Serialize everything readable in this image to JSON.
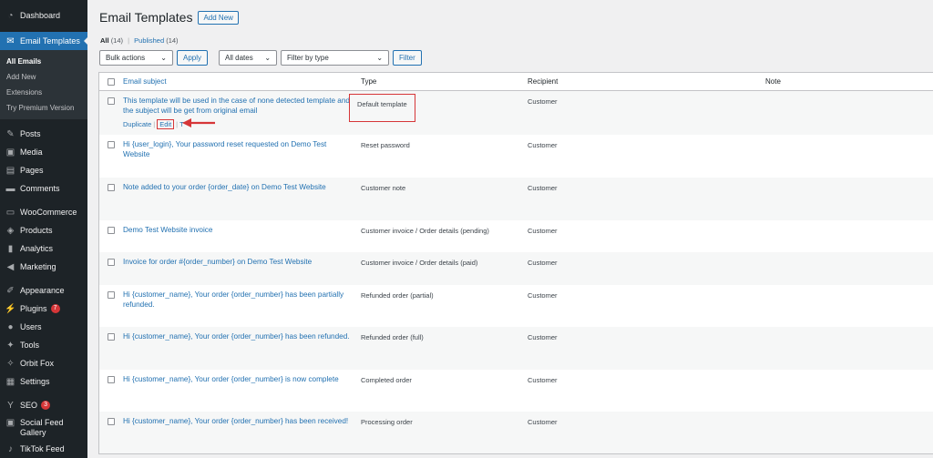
{
  "sidebar": {
    "items_top": [
      {
        "label": "Dashboard",
        "icon": "dashboard-icon",
        "glyph": "◔"
      }
    ],
    "current": {
      "label": "Email Templates",
      "icon": "email-icon",
      "glyph": "✉"
    },
    "submenu": [
      "All Emails",
      "Add New",
      "Extensions",
      "Try Premium Version"
    ],
    "items_mid": [
      {
        "label": "Posts",
        "icon": "pin-icon",
        "glyph": "✎"
      },
      {
        "label": "Media",
        "icon": "media-icon",
        "glyph": "▣"
      },
      {
        "label": "Pages",
        "icon": "pages-icon",
        "glyph": "▤"
      },
      {
        "label": "Comments",
        "icon": "comments-icon",
        "glyph": "▬"
      }
    ],
    "items_shop": [
      {
        "label": "WooCommerce",
        "icon": "woocommerce-icon",
        "glyph": "▭"
      },
      {
        "label": "Products",
        "icon": "products-icon",
        "glyph": "◈"
      },
      {
        "label": "Analytics",
        "icon": "analytics-icon",
        "glyph": "▮"
      },
      {
        "label": "Marketing",
        "icon": "marketing-icon",
        "glyph": "◀"
      }
    ],
    "items_admin": [
      {
        "label": "Appearance",
        "icon": "appearance-icon",
        "glyph": "✐"
      },
      {
        "label": "Plugins",
        "icon": "plugins-icon",
        "glyph": "⚡",
        "badge": "7"
      },
      {
        "label": "Users",
        "icon": "users-icon",
        "glyph": "●"
      },
      {
        "label": "Tools",
        "icon": "tools-icon",
        "glyph": "✦"
      },
      {
        "label": "Orbit Fox",
        "icon": "orbit-fox-icon",
        "glyph": "✧"
      },
      {
        "label": "Settings",
        "icon": "settings-icon",
        "glyph": "▦"
      }
    ],
    "items_bottom": [
      {
        "label": "SEO",
        "icon": "seo-icon",
        "glyph": "Y",
        "badge": "3"
      },
      {
        "label": "Social Feed Gallery",
        "icon": "social-feed-icon",
        "glyph": "▣"
      },
      {
        "label": "TikTok Feed",
        "icon": "tiktok-icon",
        "glyph": "♪"
      }
    ]
  },
  "header": {
    "title": "Email Templates",
    "add_new": "Add New"
  },
  "views": {
    "all": "All",
    "all_count": "(14)",
    "separator": "|",
    "published": "Published",
    "published_count": "(14)"
  },
  "filters": {
    "bulk_actions": "Bulk actions",
    "apply": "Apply",
    "dates": "All dates",
    "type": "Filter by type",
    "filter": "Filter"
  },
  "columns": {
    "subject": "Email subject",
    "type": "Type",
    "recipient": "Recipient",
    "note": "Note"
  },
  "row_actions": {
    "duplicate": "Duplicate",
    "separator": "|",
    "edit": "Edit",
    "trash": "T"
  },
  "rows": [
    {
      "subject": "This template will be used in the case of none detected template and the subject will be get from original email",
      "type": "Default template",
      "recipient": "Customer",
      "note": ""
    },
    {
      "subject": "Hi {user_login}, Your password reset requested on Demo Test Website",
      "type": "Reset password",
      "recipient": "Customer",
      "note": ""
    },
    {
      "subject": "Note added to your order {order_date} on Demo Test Website",
      "type": "Customer note",
      "recipient": "Customer",
      "note": ""
    },
    {
      "subject": "Demo Test Website invoice",
      "type": "Customer invoice / Order details (pending)",
      "recipient": "Customer",
      "note": ""
    },
    {
      "subject": "Invoice for order #{order_number} on Demo Test Website",
      "type": "Customer invoice / Order details (paid)",
      "recipient": "Customer",
      "note": ""
    },
    {
      "subject": "Hi {customer_name}, Your order {order_number} has been partially refunded.",
      "type": "Refunded order (partial)",
      "recipient": "Customer",
      "note": ""
    },
    {
      "subject": "Hi {customer_name}, Your order {order_number} has been refunded.",
      "type": "Refunded order (full)",
      "recipient": "Customer",
      "note": ""
    },
    {
      "subject": "Hi {customer_name}, Your order {order_number} is now complete",
      "type": "Completed order",
      "recipient": "Customer",
      "note": ""
    },
    {
      "subject": "Hi {customer_name}, Your order {order_number} has been received!",
      "type": "Processing order",
      "recipient": "Customer",
      "note": ""
    }
  ],
  "colors": {
    "accent": "#2271b1",
    "sidebar": "#1d2327",
    "highlight": "#d63638"
  }
}
